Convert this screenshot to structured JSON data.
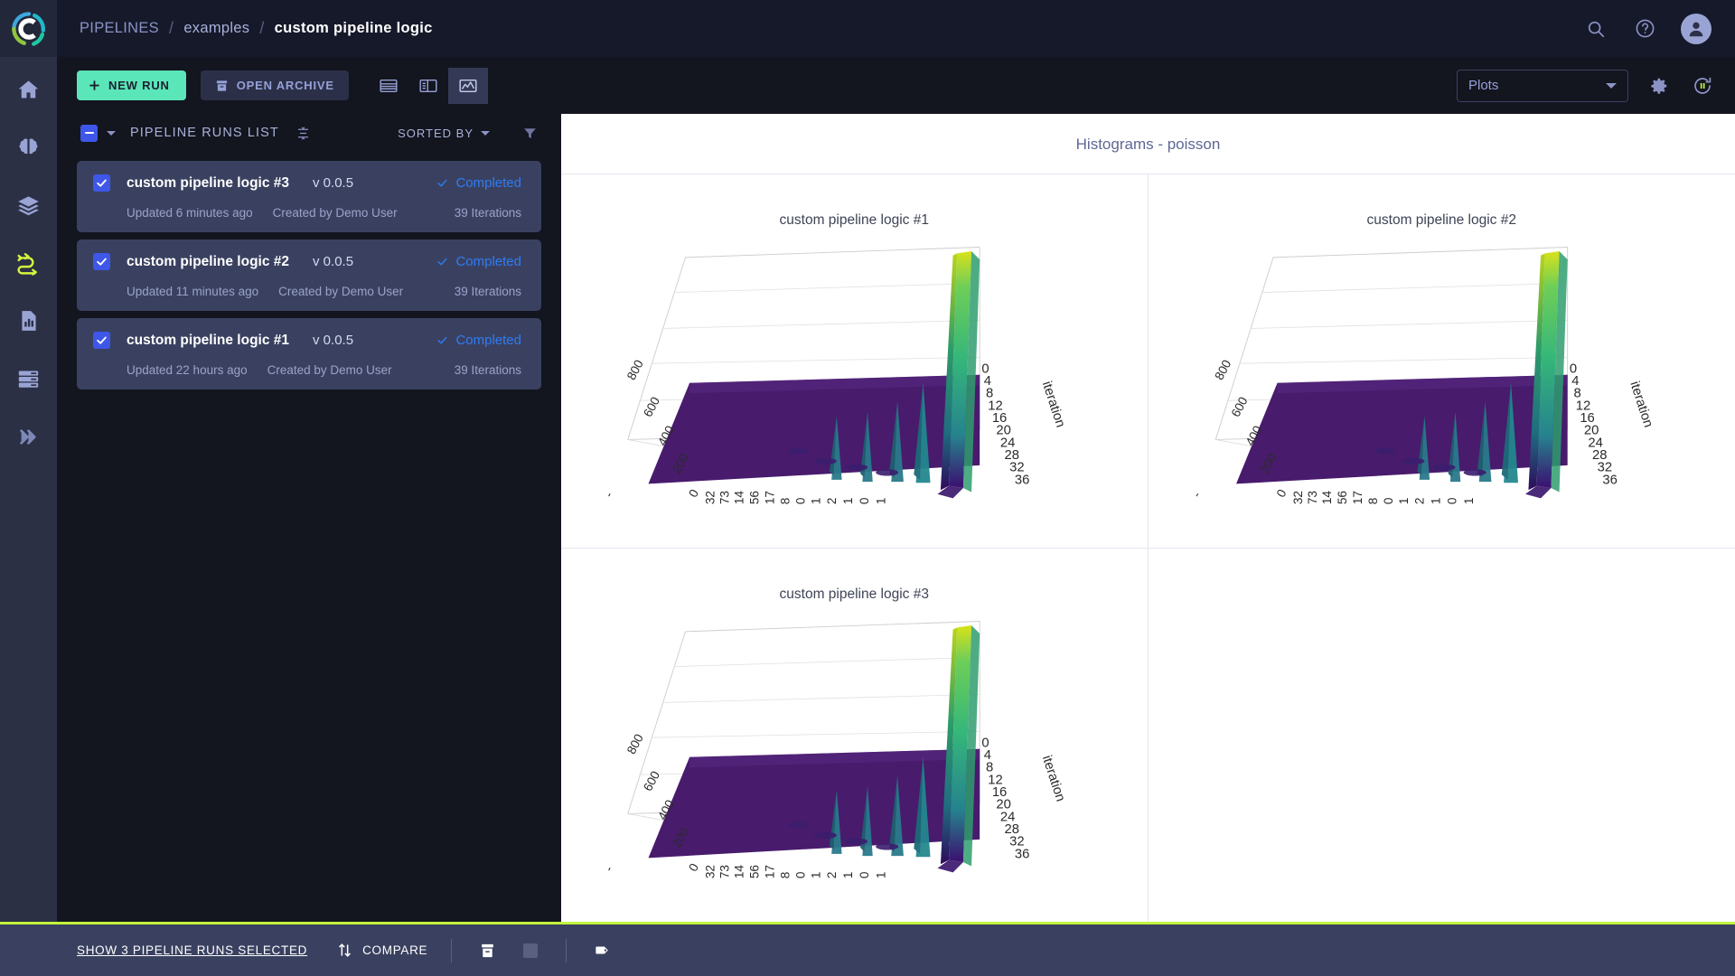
{
  "header": {
    "logo_icon": "clearml-logo-icon",
    "breadcrumb": {
      "root": "PIPELINES",
      "sep": "/",
      "project": "examples",
      "current": "custom pipeline logic"
    },
    "search_icon": "search-icon",
    "help_icon": "help-circle-icon",
    "avatar_icon": "user-avatar-icon"
  },
  "rail": {
    "items": [
      {
        "name": "home",
        "icon": "home-icon",
        "active": false
      },
      {
        "name": "models",
        "icon": "brain-icon",
        "active": false
      },
      {
        "name": "datasets",
        "icon": "layers-icon",
        "active": false
      },
      {
        "name": "pipelines",
        "icon": "pipeline-icon",
        "active": true
      },
      {
        "name": "reports",
        "icon": "report-chart-icon",
        "active": false
      },
      {
        "name": "workers",
        "icon": "server-rack-icon",
        "active": false
      },
      {
        "name": "expand",
        "icon": "double-chevron-right-icon",
        "active": false
      }
    ]
  },
  "toolbar": {
    "new_run_label": "NEW RUN",
    "new_run_icon": "plus-icon",
    "open_archive_label": "OPEN ARCHIVE",
    "open_archive_icon": "archive-box-icon",
    "view_toggles": [
      {
        "name": "table-view",
        "icon": "table-rows-icon",
        "active": false
      },
      {
        "name": "split-view",
        "icon": "split-panel-icon",
        "active": false
      },
      {
        "name": "plots-view",
        "icon": "line-chart-icon",
        "active": true
      }
    ],
    "plots_select_value": "Plots",
    "settings_icon": "gear-icon",
    "refresh_icon": "auto-refresh-pause-icon",
    "accent_color": "#5ae6b8"
  },
  "runs_panel": {
    "select_all_state": "indeterminate",
    "title": "PIPELINE RUNS LIST",
    "columns_icon": "column-settings-icon",
    "sorted_by_label": "SORTED BY",
    "filter_icon": "filter-icon",
    "runs": [
      {
        "name": "custom pipeline logic #3",
        "version": "v 0.0.5",
        "status": "Completed",
        "status_icon": "check-icon",
        "updated": "Updated 6 minutes ago",
        "creator": "Created by Demo User",
        "iterations": "39 Iterations",
        "selected": true
      },
      {
        "name": "custom pipeline logic #2",
        "version": "v 0.0.5",
        "status": "Completed",
        "status_icon": "check-icon",
        "updated": "Updated 11 minutes ago",
        "creator": "Created by Demo User",
        "iterations": "39 Iterations",
        "selected": true
      },
      {
        "name": "custom pipeline logic #1",
        "version": "v 0.0.5",
        "status": "Completed",
        "status_icon": "check-icon",
        "updated": "Updated 22 hours ago",
        "creator": "Created by Demo User",
        "iterations": "39 Iterations",
        "selected": true
      }
    ],
    "status_color": "#2e7bf6"
  },
  "plots": {
    "group_title": "Histograms - poisson",
    "cells": [
      {
        "title": "custom pipeline logic #1"
      },
      {
        "title": "custom pipeline logic #2"
      },
      {
        "title": "custom pipeline logic #3"
      },
      {
        "title": ""
      }
    ]
  },
  "chart_data": {
    "type": "surface",
    "title": "Histograms - poisson",
    "subplots": [
      "custom pipeline logic #1",
      "custom pipeline logic #2",
      "custom pipeline logic #3"
    ],
    "projection": "3d",
    "colorscale": "viridis",
    "xlabel": "",
    "ylabel": "iteration",
    "zlabel": "",
    "x_ticklabels": [
      "0",
      "32",
      "73",
      "14",
      "56",
      "17",
      "8",
      "0",
      "1",
      "2",
      "1",
      "0",
      "1"
    ],
    "y_ticklabels": [
      "0",
      "4",
      "8",
      "12",
      "16",
      "20",
      "24",
      "28",
      "32",
      "36"
    ],
    "y_range": [
      0,
      39
    ],
    "z_ticklabels": [
      "200",
      "400",
      "600",
      "800"
    ],
    "z_range": [
      0,
      1000
    ],
    "grid": true,
    "legend": "none",
    "surface_description": "Poisson histogram counts per iteration; a large green ridge at the near-zero bin rises to ~1000 across all iterations, with a flat purple plateau elsewhere and small teal spikes.",
    "series": [
      {
        "name": "custom pipeline logic #1",
        "peak_value": 1000,
        "peak_bin": "0",
        "baseline": 0,
        "iterations": 39
      },
      {
        "name": "custom pipeline logic #2",
        "peak_value": 1000,
        "peak_bin": "0",
        "baseline": 0,
        "iterations": 39
      },
      {
        "name": "custom pipeline logic #3",
        "peak_value": 1000,
        "peak_bin": "0",
        "baseline": 0,
        "iterations": 39
      }
    ]
  },
  "bottombar": {
    "selected_label": "SHOW 3 PIPELINE RUNS SELECTED",
    "compare_label": "COMPARE",
    "compare_icon": "compare-arrows-icon",
    "archive_icon": "archive-box-icon",
    "stop_icon": "stop-square-icon",
    "tag_icon": "tag-icon",
    "accent_color": "#c3f53c"
  }
}
